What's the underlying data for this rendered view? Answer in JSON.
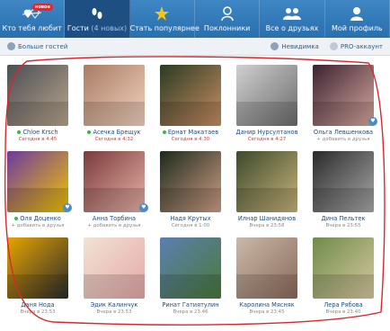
{
  "nav": [
    {
      "label": "Кто тебя любит",
      "sub": "",
      "icon": "hearts-arrow-icon",
      "badge": "новое",
      "active": false
    },
    {
      "label": "Гости",
      "sub": " (4 новых)",
      "icon": "footprints-icon",
      "badge": "",
      "active": true
    },
    {
      "label": "Стать популярнее",
      "sub": "",
      "icon": "star-user-icon",
      "badge": "",
      "active": false
    },
    {
      "label": "Поклонники",
      "sub": "",
      "icon": "user-icon",
      "badge": "",
      "active": false
    },
    {
      "label": "Все о друзьях",
      "sub": "",
      "icon": "users-group-icon",
      "badge": "",
      "active": false
    },
    {
      "label": "Мой профиль",
      "sub": "",
      "icon": "profile-icon",
      "badge": "",
      "active": false
    }
  ],
  "toolbar": {
    "more_guests": "Больше гостей",
    "invisible": "Невидимка",
    "pro": "PRO-аккаунт"
  },
  "guests": [
    {
      "name": "Chloe Krsch",
      "meta": "Сегодня в 4:45",
      "online": true,
      "today": true,
      "colors": [
        "#4b4f55",
        "#b9a58c"
      ]
    },
    {
      "name": "Асечка Брещук",
      "meta": "Сегодня в 4:32",
      "online": true,
      "today": true,
      "colors": [
        "#a87c62",
        "#f2d2c0"
      ]
    },
    {
      "name": "Ернат Макатаев",
      "meta": "Сегодня в 4:30",
      "online": true,
      "today": true,
      "colors": [
        "#2a3b22",
        "#c98e63"
      ]
    },
    {
      "name": "Данир Нурсултанов",
      "meta": "Сегодня в 4:27",
      "online": false,
      "today": true,
      "colors": [
        "#cfcfcf",
        "#6b6b6b"
      ]
    },
    {
      "name": "Ольга Левшенкова",
      "meta": "+ добавить в друзья",
      "online": false,
      "today": false,
      "colors": [
        "#3a2230",
        "#d9a9a0"
      ]
    },
    {
      "name": "Оля Доценко",
      "meta": "+ добавить в друзья",
      "online": true,
      "today": false,
      "colors": [
        "#6c3aa0",
        "#f2c400"
      ]
    },
    {
      "name": "Анна Торбина",
      "meta": "+ добавить в друзья",
      "online": false,
      "today": false,
      "colors": [
        "#7a3b3b",
        "#e7b2a8"
      ]
    },
    {
      "name": "Надя Крутых",
      "meta": "Сегодня в 1:00",
      "online": false,
      "today": false,
      "colors": [
        "#1c2a1c",
        "#cf9f86"
      ]
    },
    {
      "name": "Илнар Шанидянов",
      "meta": "Вчера в 23:58",
      "online": false,
      "today": false,
      "colors": [
        "#3d4a2c",
        "#c6b37a"
      ]
    },
    {
      "name": "Дина Пельтек",
      "meta": "Вчера в 23:55",
      "online": false,
      "today": false,
      "colors": [
        "#2a2a2a",
        "#a9a9a9"
      ]
    },
    {
      "name": "Даня Нода",
      "meta": "Вчера в 23:53",
      "online": false,
      "today": false,
      "colors": [
        "#e7a400",
        "#2b2b2b"
      ]
    },
    {
      "name": "Эдик Калинчук",
      "meta": "Вчера в 23:53",
      "online": false,
      "today": false,
      "colors": [
        "#f0e3d2",
        "#e6a8a8"
      ]
    },
    {
      "name": "Ринат Гатиятулин",
      "meta": "Вчера в 23:46",
      "online": false,
      "today": false,
      "colors": [
        "#5b7fb0",
        "#4a7a3a"
      ]
    },
    {
      "name": "Каролина Мясняк",
      "meta": "Вчера в 23:45",
      "online": false,
      "today": false,
      "colors": [
        "#c9b8a8",
        "#8a6a5a"
      ]
    },
    {
      "name": "Лера Рябова",
      "meta": "Вчера в 23:40",
      "online": false,
      "today": false,
      "colors": [
        "#6e8b4a",
        "#d8c8a0"
      ]
    }
  ]
}
